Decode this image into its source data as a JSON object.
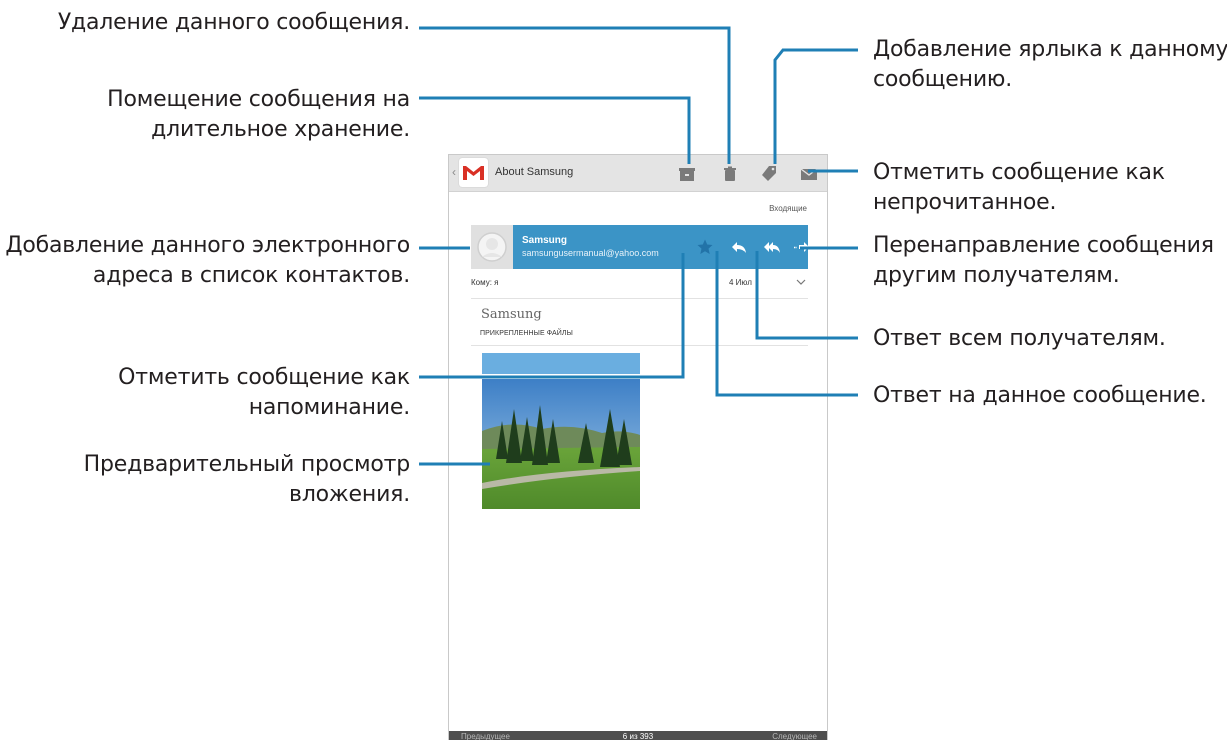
{
  "callouts": {
    "delete": [
      "Удаление данного сообщения."
    ],
    "archive": [
      "Помещение сообщения на",
      "длительное хранение."
    ],
    "add_contact": [
      "Добавление данного электронного",
      "адреса в список контактов."
    ],
    "star": [
      "Отметить сообщение как",
      "напоминание."
    ],
    "preview": [
      "Предварительный просмотр",
      "вложения."
    ],
    "label": [
      "Добавление ярлыка к данному",
      "сообщению."
    ],
    "mark_unread": [
      "Отметить сообщение как",
      "непрочитанное."
    ],
    "forward": [
      "Перенаправление сообщения",
      "другим получателям."
    ],
    "reply_all": [
      "Ответ всем получателям."
    ],
    "reply": [
      "Ответ на данное сообщение."
    ]
  },
  "screen": {
    "actionbar": {
      "title": "About Samsung",
      "icons": [
        "gmail-logo-icon",
        "archive-icon",
        "trash-icon",
        "label-icon",
        "mail-icon"
      ]
    },
    "folder_label": "Входящие",
    "sender": {
      "name": "Samsung",
      "email": "samsungusermanual@yahoo.com",
      "icons": [
        "star-icon",
        "reply-icon",
        "reply-all-icon",
        "forward-icon"
      ]
    },
    "to_row": {
      "to": "Кому: я",
      "date": "4 Июл"
    },
    "subject": "Samsung",
    "attachments_label": "ПРИКРЕПЛЕННЫЕ ФАЙЛЫ",
    "bottom": {
      "prev": "Предыдущее",
      "count": "6 из 393",
      "next": "Следующее"
    }
  },
  "colors": {
    "accent": "#3b94c6",
    "leader_line": "#1f7fb5",
    "actionbar_bg": "#e4e4e4",
    "bottombar_bg": "#4e4e4e"
  }
}
